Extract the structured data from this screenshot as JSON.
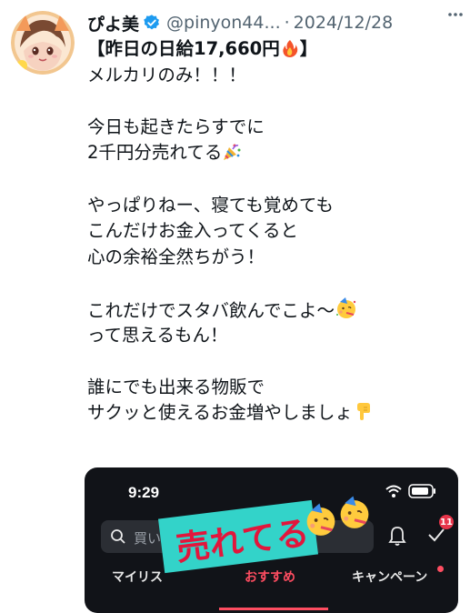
{
  "tweet": {
    "author_name": "ぴよ美",
    "handle": "@pinyon44...",
    "separator": "·",
    "date": "2024/12/28",
    "lines": [
      "【昨日の日給17,660円",
      "メルカリのみ！！！",
      "",
      "今日も起きたらすでに",
      "2千円分売れてる",
      "",
      "やっぱりねー、寝ても覚めても",
      "こんだけお金入ってくると",
      "心の余裕全然ちがう！",
      "",
      "これだけでスタバ飲んでこよ〜",
      "って思えるもん！",
      "",
      "誰にでも出来る物販で",
      "サクッと使えるお金増やしましょ"
    ],
    "line0_close": "】"
  },
  "icons": {
    "verified": "verified-badge-icon",
    "more": "more-options-icon",
    "fire": "fire-emoji",
    "party_popper": "party-popper-emoji",
    "party_face": "partying-face-emoji",
    "pointing_down": "backhand-index-pointing-down-emoji"
  },
  "media": {
    "status_time": "9:29",
    "search_placeholder": "買いたい",
    "notification_count": "11",
    "overlay_text": "売れてる",
    "tabs": [
      "マイリス",
      "おすすめ",
      "キャンペーン"
    ]
  },
  "colors": {
    "verified_blue": "#1d9bf0",
    "text_primary": "#0f1419",
    "text_secondary": "#536471",
    "app_accent": "#ff4d61",
    "overlay_banner": "#33d3c9",
    "overlay_text": "#e2163c"
  }
}
